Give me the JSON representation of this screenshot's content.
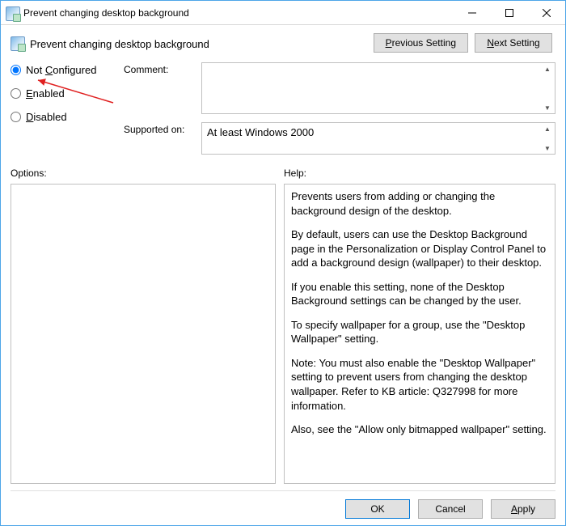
{
  "window": {
    "title": "Prevent changing desktop background"
  },
  "heading": {
    "text": "Prevent changing desktop background"
  },
  "nav": {
    "prev_pre": "",
    "prev_u": "P",
    "prev_post": "revious Setting",
    "next_pre": "",
    "next_u": "N",
    "next_post": "ext Setting"
  },
  "radios": {
    "nc_pre": "Not ",
    "nc_u": "C",
    "nc_post": "onfigured",
    "en_u": "E",
    "en_post": "nabled",
    "di_u": "D",
    "di_post": "isabled",
    "selected": "not_configured"
  },
  "labels": {
    "comment": "Comment:",
    "supported": "Supported on:",
    "options": "Options:",
    "help": "Help:"
  },
  "supported_value": "At least Windows 2000",
  "help": {
    "p1": "Prevents users from adding or changing the background design of the desktop.",
    "p2": "By default, users can use the Desktop Background page in the Personalization or Display Control Panel to add a background design (wallpaper) to their desktop.",
    "p3": "If you enable this setting, none of the Desktop Background settings can be changed by the user.",
    "p4": "To specify wallpaper for a group, use the \"Desktop Wallpaper\" setting.",
    "p5": "Note: You must also enable the \"Desktop Wallpaper\" setting to prevent users from changing the desktop wallpaper. Refer to KB article: Q327998 for more information.",
    "p6": "Also, see the \"Allow only bitmapped wallpaper\" setting."
  },
  "footer": {
    "ok": "OK",
    "cancel": "Cancel",
    "apply_u": "A",
    "apply_post": "pply"
  }
}
